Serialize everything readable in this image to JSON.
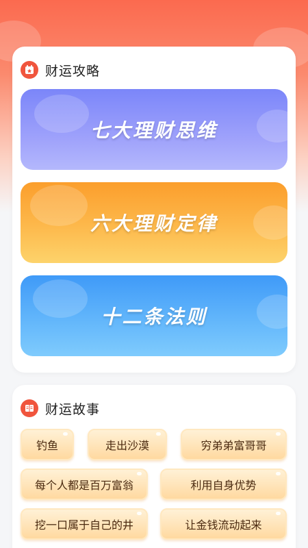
{
  "section1": {
    "title": "财运攻略",
    "banners": [
      {
        "label": "七大理财思维"
      },
      {
        "label": "六大理财定律"
      },
      {
        "label": "十二条法则"
      }
    ]
  },
  "section2": {
    "title": "财运故事",
    "stories": [
      {
        "label": "钓鱼"
      },
      {
        "label": "走出沙漠"
      },
      {
        "label": "穷弟弟富哥哥"
      },
      {
        "label": "每个人都是百万富翁"
      },
      {
        "label": "利用自身优势"
      },
      {
        "label": "挖一口属于自己的井"
      },
      {
        "label": "让金钱流动起来"
      }
    ]
  },
  "colors": {
    "header_red": "#fb6a4f",
    "icon_red": "#f0553d",
    "banner_purple": "#8f93fa",
    "banner_orange": "#fdb447",
    "banner_blue": "#5aaffa",
    "story_button": "#ffd9a0"
  }
}
